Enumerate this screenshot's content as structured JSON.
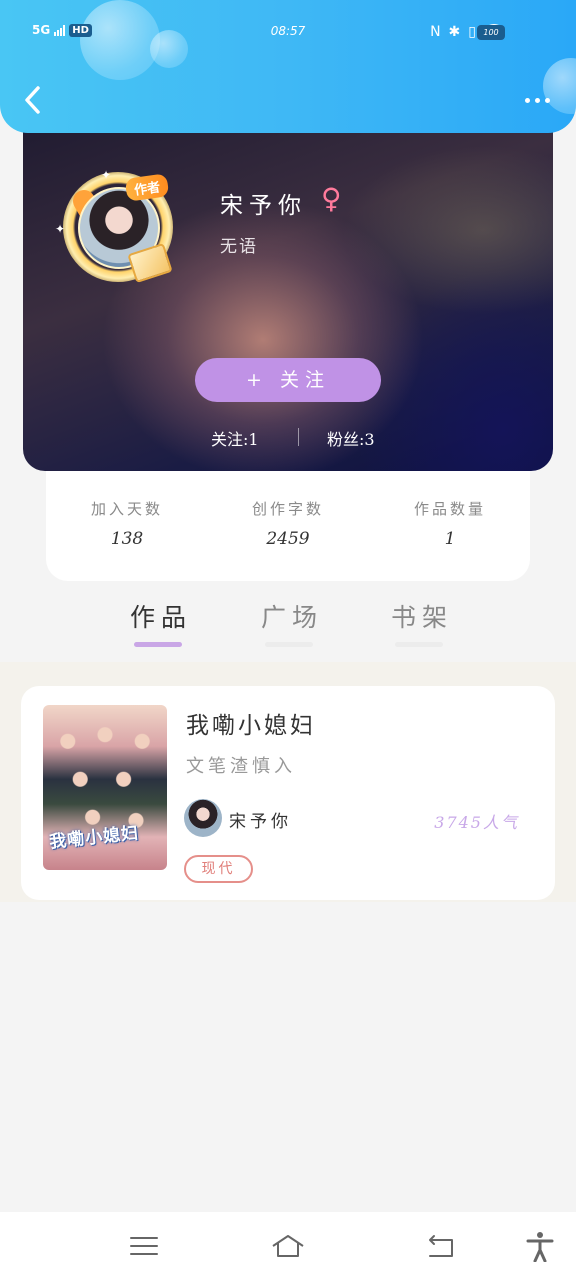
{
  "status_bar": {
    "network": "5G",
    "hd": "HD",
    "time": "08:57",
    "battery": "100"
  },
  "header": {
    "back_icon": "chevron-left-icon",
    "more_icon": "more-dots-icon"
  },
  "profile": {
    "author_badge": "作者",
    "name": "宋予你",
    "gender_symbol": "♀",
    "bio": "无语",
    "follow_button": "+ 关注",
    "following_label": "关注:1",
    "fans_label": "粉丝:3",
    "gender_color": "#ff7b9c",
    "follow_button_color": "#c092e6"
  },
  "stats": [
    {
      "label": "加入天数",
      "value": "138"
    },
    {
      "label": "创作字数",
      "value": "2459"
    },
    {
      "label": "作品数量",
      "value": "1"
    }
  ],
  "tabs": [
    {
      "label": "作品",
      "active": true
    },
    {
      "label": "广场",
      "active": false
    },
    {
      "label": "书架",
      "active": false
    }
  ],
  "works": [
    {
      "cover_text": "我嘞小媳妇",
      "title": "我嘞小媳妇",
      "description": "文笔渣慎入",
      "author": "宋予你",
      "popularity": "3745人气",
      "genre": "现代"
    }
  ],
  "nav_bar": {
    "menu_icon": "menu-icon",
    "home_icon": "home-icon",
    "back_icon": "back-arrow-icon",
    "accessibility_icon": "accessibility-icon"
  }
}
